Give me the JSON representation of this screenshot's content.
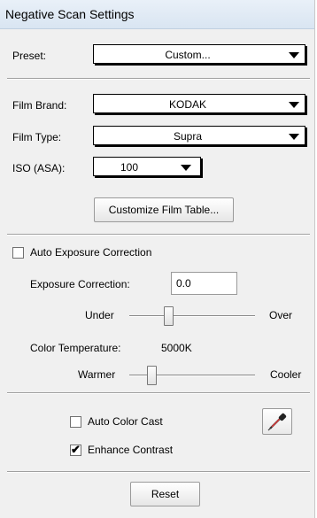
{
  "window": {
    "title": "Negative Scan Settings"
  },
  "preset": {
    "label": "Preset:",
    "value": "Custom..."
  },
  "film": {
    "brand_label": "Film Brand:",
    "brand_value": "KODAK",
    "type_label": "Film Type:",
    "type_value": "Supra",
    "iso_label": "ISO (ASA):",
    "iso_value": "100",
    "customize_button": "Customize Film Table..."
  },
  "exposure": {
    "auto_label": "Auto Exposure Correction",
    "auto_checked": false,
    "correction_label": "Exposure Correction:",
    "correction_value": "0.0",
    "slider_left": "Under",
    "slider_right": "Over",
    "slider_level": 0.31
  },
  "color_temperature": {
    "label": "Color Temperature:",
    "value": "5000K",
    "slider_left": "Warmer",
    "slider_right": "Cooler",
    "slider_level": 0.18
  },
  "color": {
    "auto_cast_label": "Auto Color Cast",
    "auto_cast_checked": false,
    "enhance_label": "Enhance Contrast",
    "enhance_checked": true,
    "picker_icon": "eyedropper-icon"
  },
  "footer": {
    "reset_button": "Reset"
  }
}
